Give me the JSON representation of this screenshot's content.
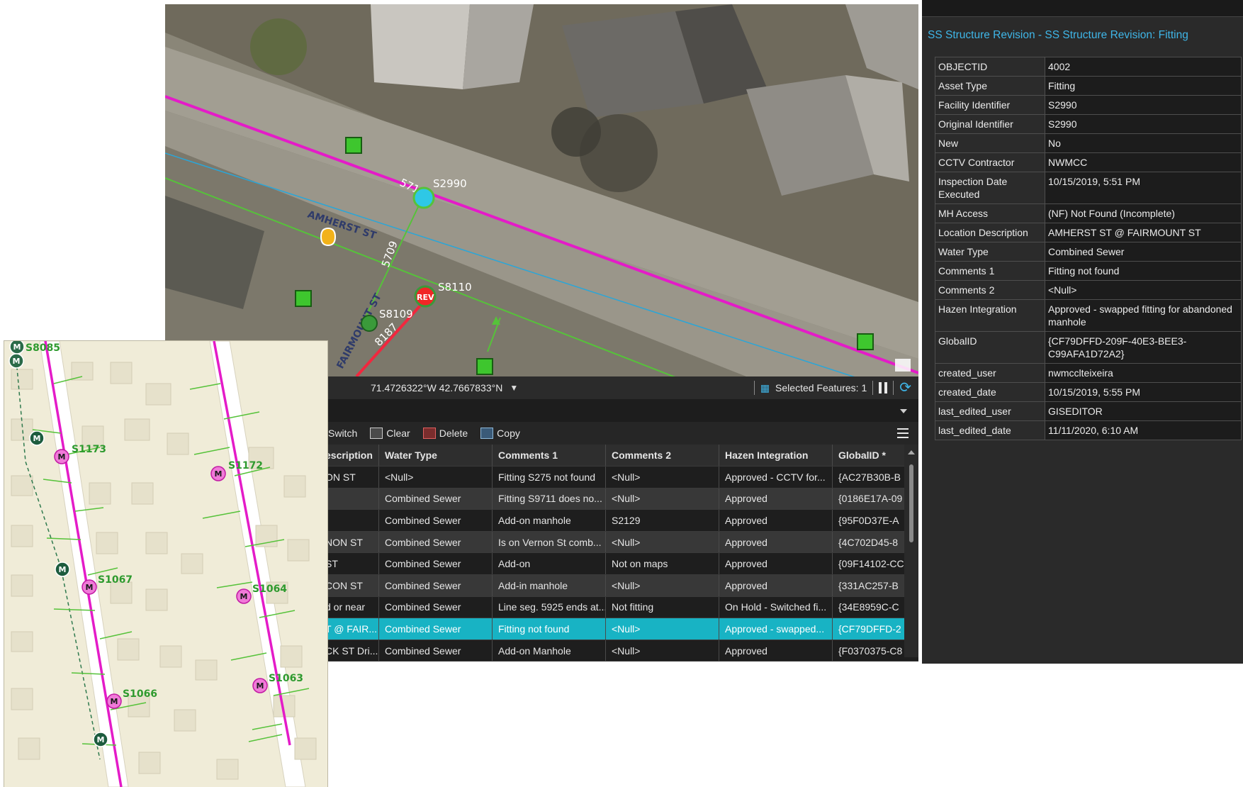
{
  "aerial_map": {
    "street_label": "AMHERST ST",
    "cross_street_label": "FAIRMOUNT ST",
    "labels": {
      "s2990": "S2990",
      "s8110": "S8110",
      "s8109": "S8109",
      "n5718": "5718",
      "n5709": "5709",
      "n8187": "8187",
      "rev": "REV"
    }
  },
  "status_bar": {
    "coordinates": "71.4726322°W 42.7667833°N",
    "selected_features": "Selected Features: 1"
  },
  "toolbar": {
    "switch": "Switch",
    "clear": "Clear",
    "delete": "Delete",
    "copy": "Copy"
  },
  "table": {
    "columns": [
      "escription",
      "Water Type",
      "Comments 1",
      "Comments 2",
      "Hazen Integration",
      "GlobalID *"
    ],
    "rows": [
      [
        "ON ST",
        "<Null>",
        "Fitting S275 not found",
        "<Null>",
        "Approved - CCTV for...",
        "{AC27B30B-B"
      ],
      [
        "",
        "Combined Sewer",
        "Fitting S9711 does no...",
        "<Null>",
        "Approved",
        "{0186E17A-09"
      ],
      [
        "",
        "Combined Sewer",
        "Add-on manhole",
        "S2129",
        "Approved",
        "{95F0D37E-A"
      ],
      [
        "NON ST",
        "Combined Sewer",
        "Is on Vernon St comb...",
        "<Null>",
        "Approved",
        "{4C702D45-8"
      ],
      [
        "ST",
        "Combined Sewer",
        "Add-on",
        "Not on maps",
        "Approved",
        "{09F14102-CC"
      ],
      [
        "CON ST",
        "Combined Sewer",
        "Add-in manhole",
        "<Null>",
        "Approved",
        "{331AC257-B"
      ],
      [
        "d or near",
        "Combined Sewer",
        "Line seg. 5925 ends at...",
        "Not fitting",
        "On Hold - Switched fi...",
        "{34E8959C-C"
      ],
      [
        "T @ FAIR...",
        "Combined Sewer",
        "Fitting not found",
        "<Null>",
        "Approved - swapped...",
        "{CF79DFFD-2"
      ],
      [
        "CK ST Dri...",
        "Combined Sewer",
        "Add-on Manhole",
        "<Null>",
        "Approved",
        "{F0370375-C8"
      ]
    ],
    "selected_row_index": 7
  },
  "attributes": {
    "title": "SS Structure Revision - SS Structure Revision: Fitting",
    "fields": [
      {
        "key": "OBJECTID",
        "value": "4002"
      },
      {
        "key": "Asset Type",
        "value": "Fitting"
      },
      {
        "key": "Facility Identifier",
        "value": "S2990"
      },
      {
        "key": "Original Identifier",
        "value": "S2990"
      },
      {
        "key": "New",
        "value": "No"
      },
      {
        "key": "CCTV Contractor",
        "value": "NWMCC"
      },
      {
        "key": "Inspection Date Executed",
        "value": "10/15/2019, 5:51 PM"
      },
      {
        "key": "MH Access",
        "value": "(NF) Not Found (Incomplete)"
      },
      {
        "key": "Location Description",
        "value": "AMHERST ST @ FAIRMOUNT ST"
      },
      {
        "key": "Water Type",
        "value": "Combined Sewer"
      },
      {
        "key": "Comments 1",
        "value": "Fitting not found"
      },
      {
        "key": "Comments 2",
        "value": "<Null>"
      },
      {
        "key": "Hazen Integration",
        "value": "Approved - swapped fitting for abandoned manhole"
      },
      {
        "key": "GlobalID",
        "value": "{CF79DFFD-209F-40E3-BEE3-C99AFA1D72A2}"
      },
      {
        "key": "created_user",
        "value": "nwmcclteixeira"
      },
      {
        "key": "created_date",
        "value": "10/15/2019, 5:55 PM"
      },
      {
        "key": "last_edited_user",
        "value": "GISEDITOR"
      },
      {
        "key": "last_edited_date",
        "value": "11/11/2020, 6:10 AM"
      }
    ]
  },
  "inset_map": {
    "labels": {
      "s8085": "S8085",
      "s1173": "S1173",
      "s1172": "S1172",
      "s1067": "S1067",
      "s1064": "S1064",
      "s1066": "S1066",
      "s1063": "S1063"
    },
    "manhole_letter": "M"
  },
  "colors": {
    "sewer_main": "#e41bc8",
    "lateral": "#56c23a",
    "accent": "#3fb6e8",
    "selected_row": "#18b3c4"
  }
}
